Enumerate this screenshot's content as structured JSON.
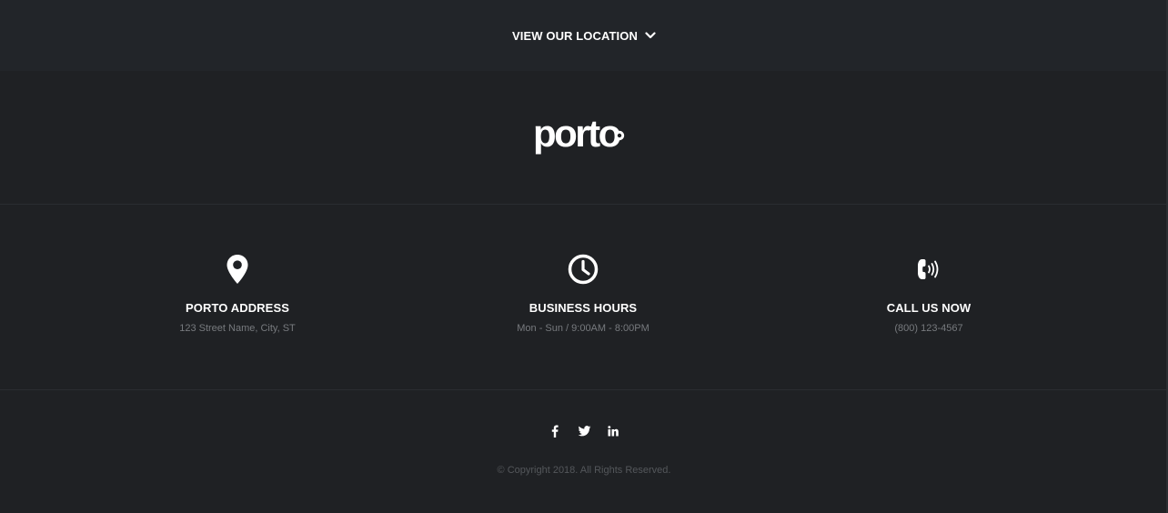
{
  "location_bar": {
    "label": "VIEW OUR LOCATION",
    "icon": "chevron-down-icon"
  },
  "logo": {
    "text": "porto"
  },
  "info": [
    {
      "icon": "map-marker-icon",
      "title": "PORTO ADDRESS",
      "text": "123 Street Name, City, ST"
    },
    {
      "icon": "clock-icon",
      "title": "BUSINESS HOURS",
      "text": "Mon - Sun / 9:00AM - 8:00PM"
    },
    {
      "icon": "phone-volume-icon",
      "title": "CALL US NOW",
      "text": "(800) 123-4567"
    }
  ],
  "social": [
    {
      "icon": "facebook-icon"
    },
    {
      "icon": "twitter-icon"
    },
    {
      "icon": "linkedin-icon"
    }
  ],
  "copyright": "© Copyright 2018. All Rights Reserved.",
  "colors": {
    "background": "#1f2124",
    "top_bar": "#222529",
    "text_primary": "#ffffff",
    "text_muted": "#777a7e",
    "copyright_text": "#54575b"
  }
}
